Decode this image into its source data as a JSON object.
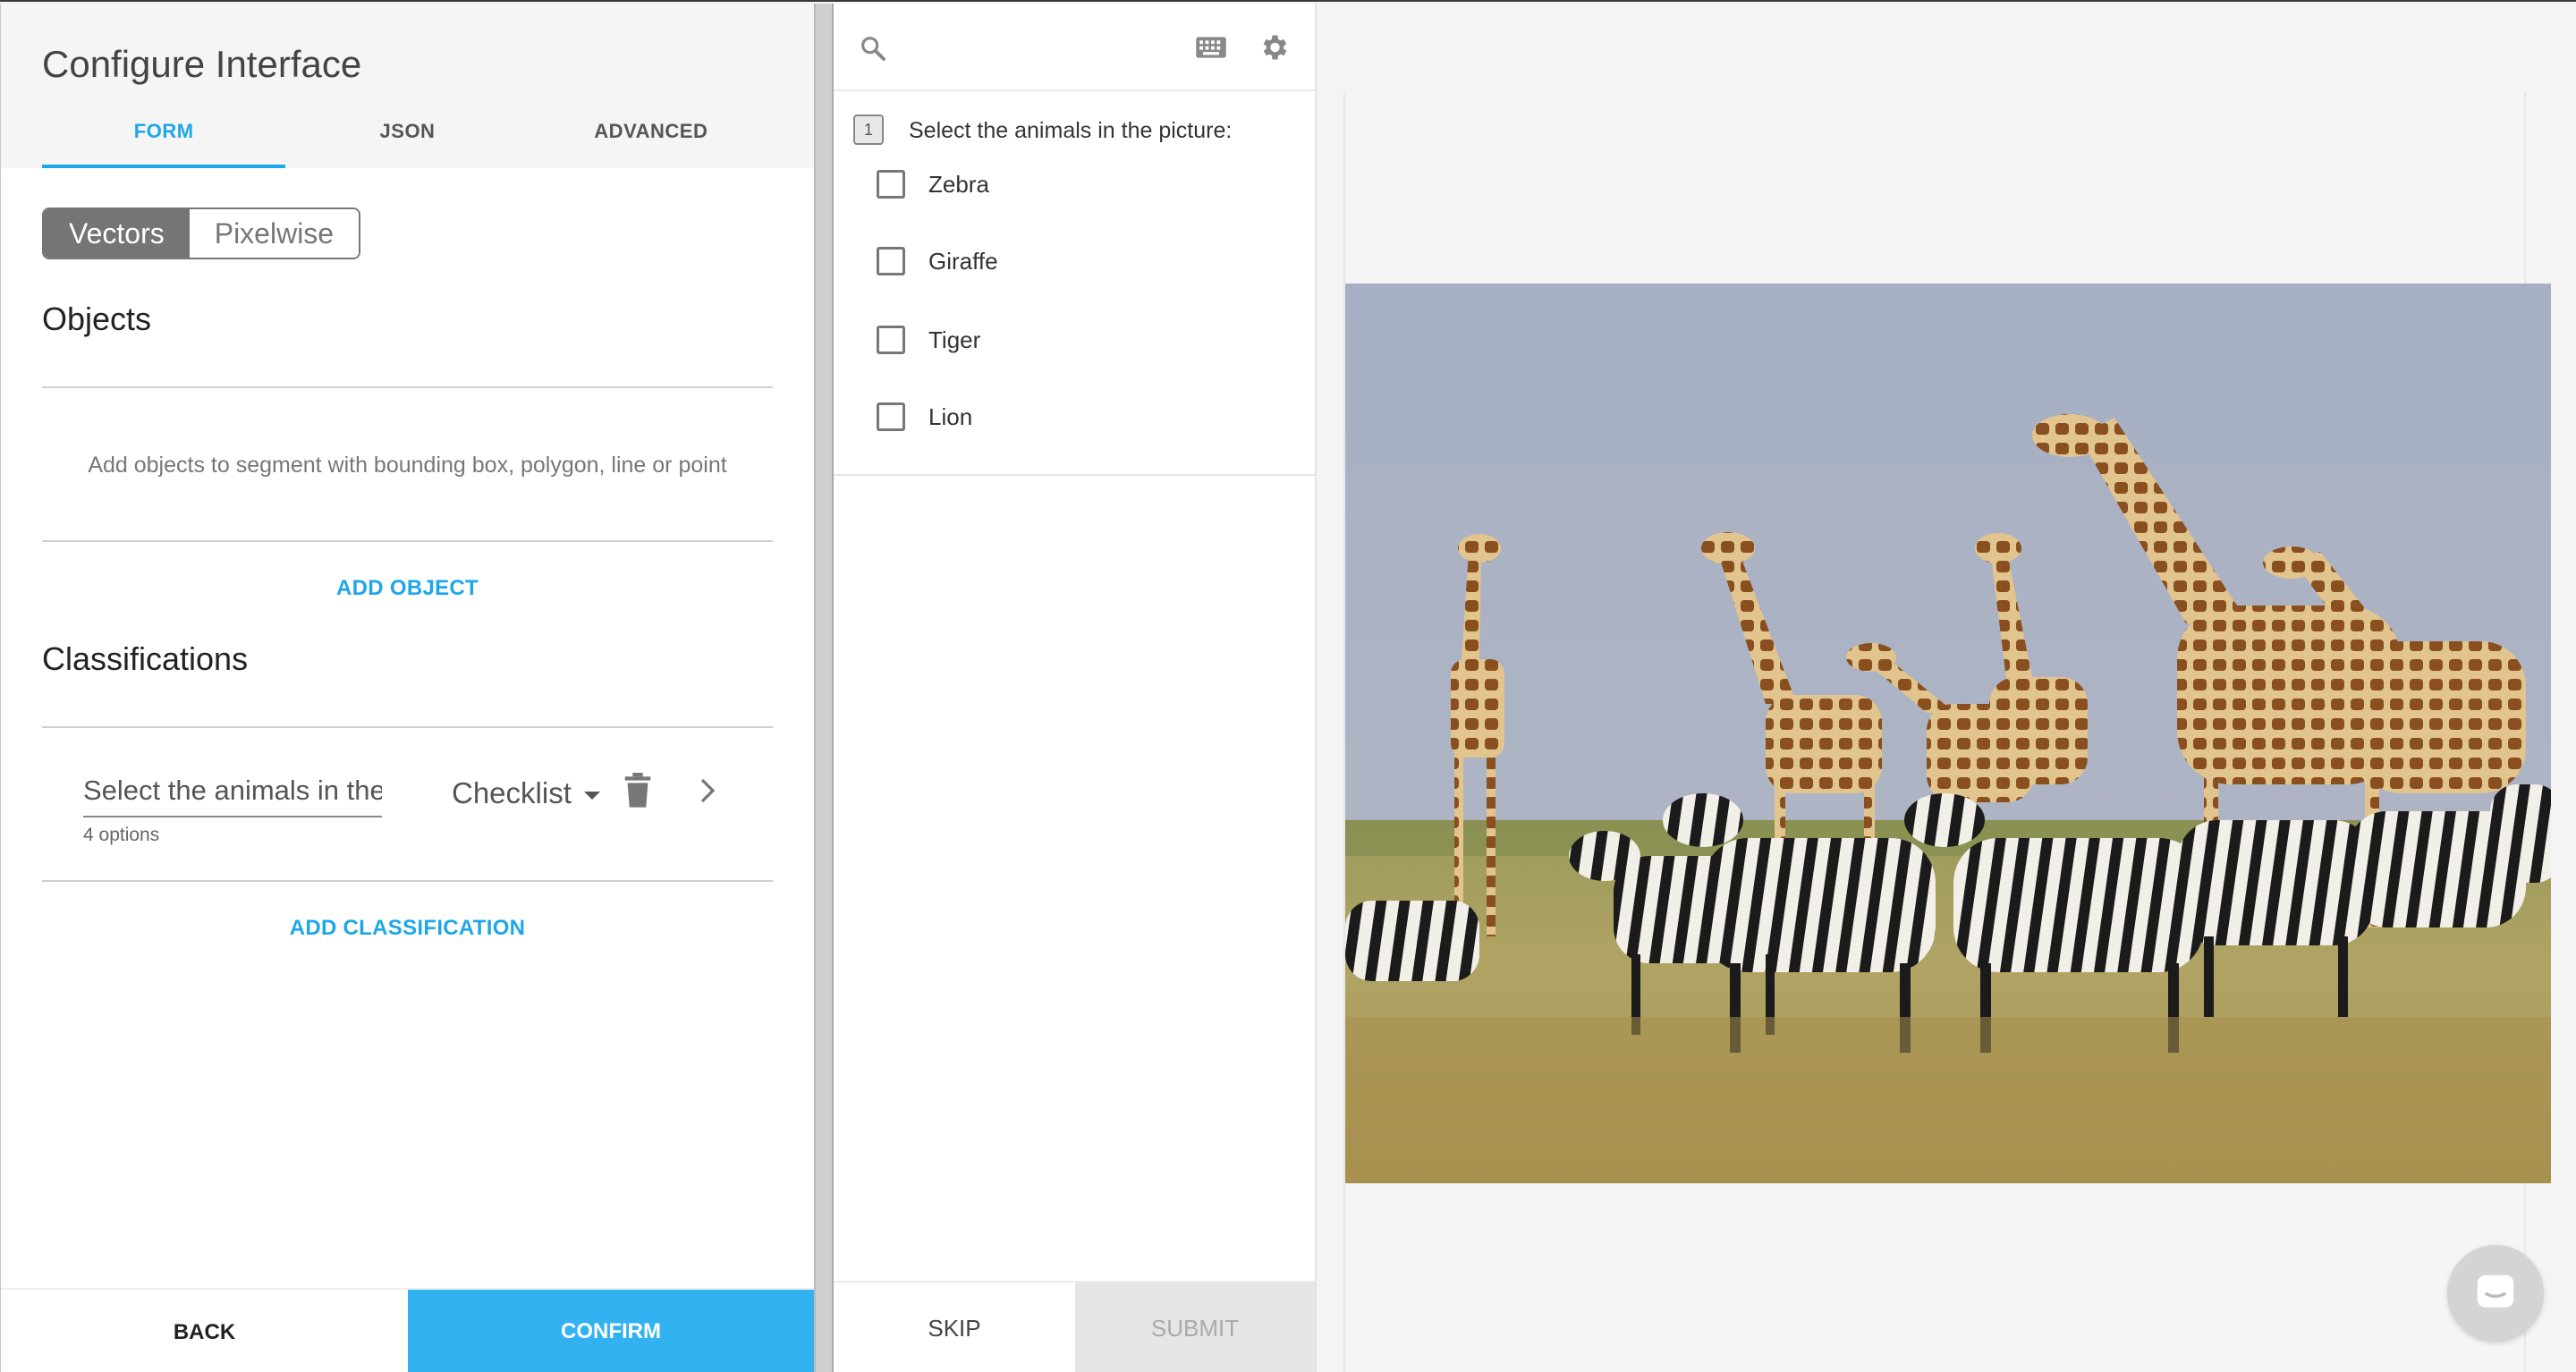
{
  "config": {
    "title": "Configure Interface",
    "tabs": [
      {
        "label": "FORM",
        "active": true
      },
      {
        "label": "JSON",
        "active": false
      },
      {
        "label": "ADVANCED",
        "active": false
      }
    ],
    "segment": {
      "options": [
        "Vectors",
        "Pixelwise"
      ],
      "selected": "Vectors"
    },
    "objects": {
      "title": "Objects",
      "hint": "Add objects to segment with bounding box, polygon, line or point",
      "add_label": "ADD OBJECT"
    },
    "classifications": {
      "title": "Classifications",
      "item": {
        "question": "Select the animals in the picture:",
        "count": "4 options",
        "type": "Checklist"
      },
      "add_label": "ADD CLASSIFICATION"
    },
    "footer": {
      "back": "BACK",
      "confirm": "CONFIRM"
    },
    "accent": "#1ea7e8"
  },
  "labeler": {
    "question_number": "1",
    "question": "Select the animals in the picture:",
    "options": [
      "Zebra",
      "Giraffe",
      "Tiger",
      "Lion"
    ],
    "footer": {
      "skip": "SKIP",
      "submit": "SUBMIT"
    }
  },
  "viewer": {
    "image": "savanna scene with giraffes and zebras",
    "chat_icon": "chat-bubble-icon"
  }
}
